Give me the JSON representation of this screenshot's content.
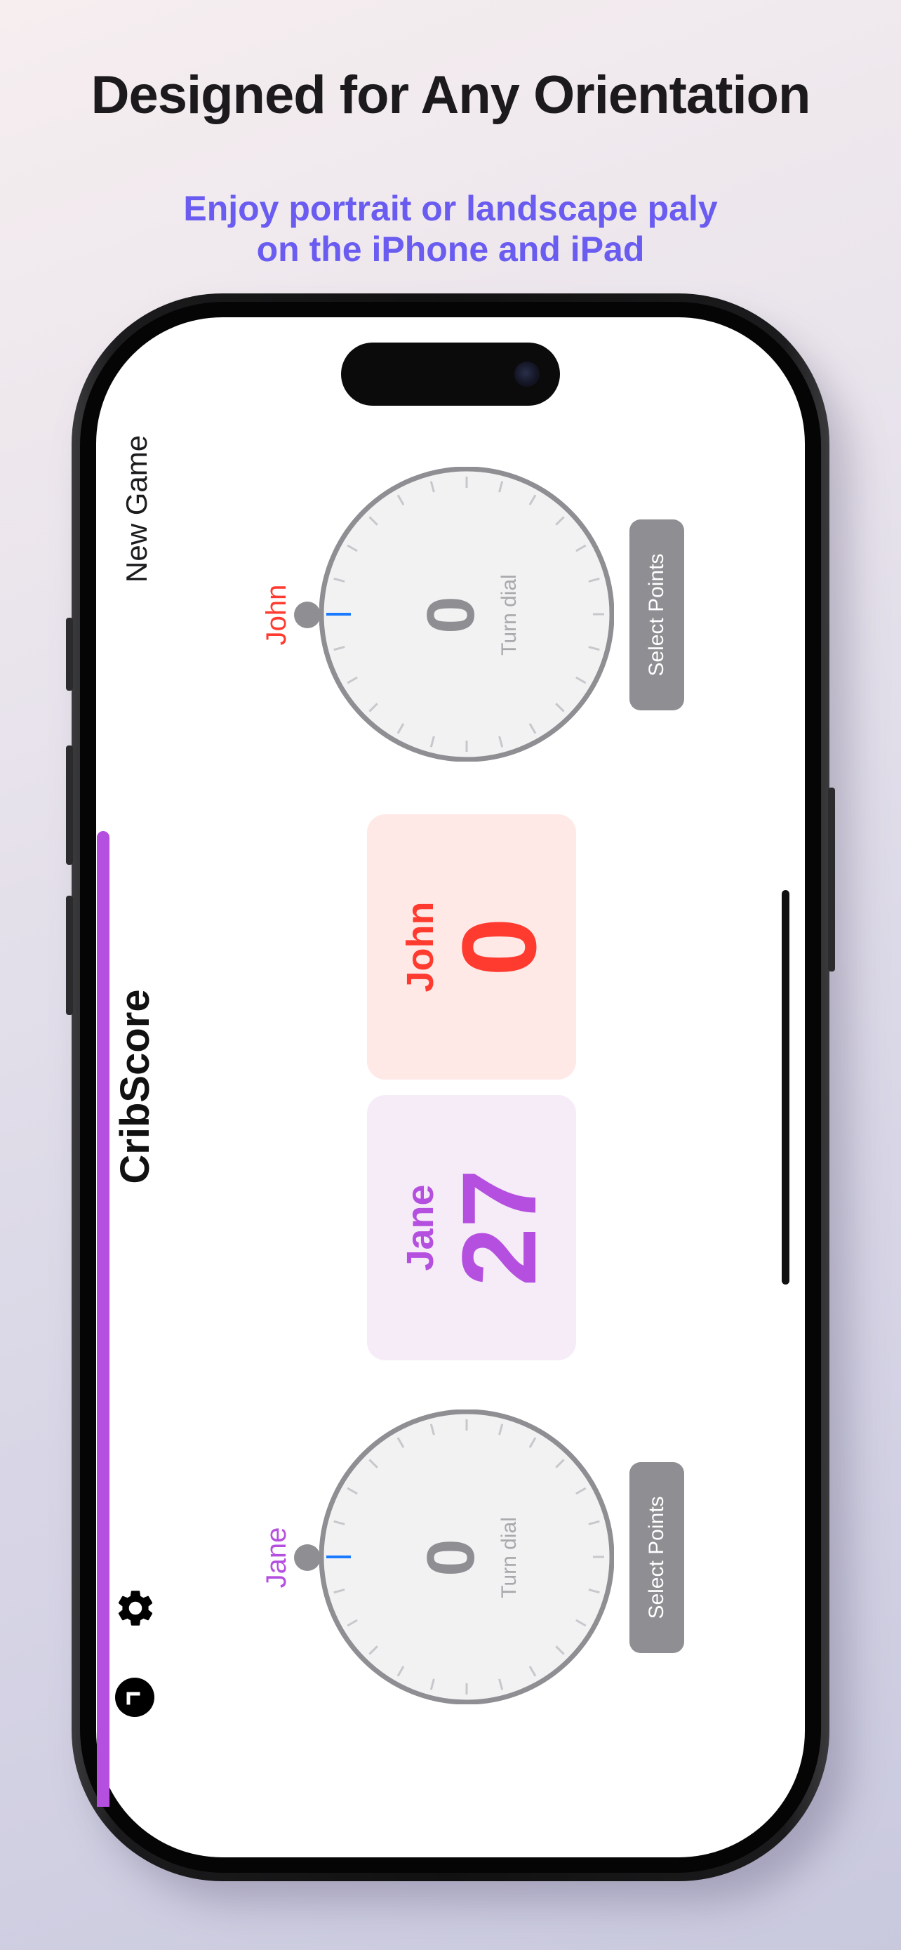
{
  "marketing": {
    "headline": "Designed for Any Orientation",
    "subhead_line1": "Enjoy portrait or landscape paly",
    "subhead_line2": "on the iPhone and iPad"
  },
  "app": {
    "title": "CribScore",
    "new_game_label": "New Game",
    "accent_color": "#b54fdf"
  },
  "players": [
    {
      "name": "John",
      "score": "0",
      "color": "#ff3b30",
      "card_bg": "#ffe9e7"
    },
    {
      "name": "Jane",
      "score": "27",
      "color": "#b54fdf",
      "card_bg": "#f5ecf8"
    }
  ],
  "dials": [
    {
      "player": "John",
      "value": "0",
      "hint": "Turn dial",
      "button_label": "Select Points"
    },
    {
      "player": "Jane",
      "value": "0",
      "hint": "Turn dial",
      "button_label": "Select Points"
    }
  ],
  "icons": {
    "settings": "gear-icon",
    "undo": "undo-icon"
  }
}
